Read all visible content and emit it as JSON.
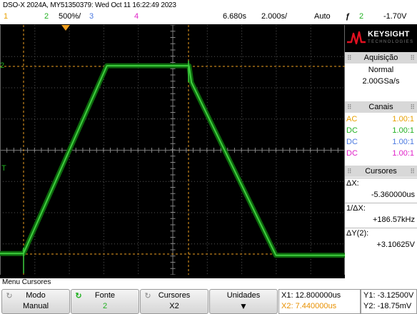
{
  "header": {
    "title": "DSO-X 2024A, MY51350379: Wed Oct 11 16:22:49 2023",
    "ch1_label": "1",
    "ch2_label": "2",
    "ch2_scale": "500%/",
    "ch3_label": "3",
    "ch4_label": "4",
    "timebase_delay": "6.680s",
    "timebase_scale": "2.000s/",
    "trigger_mode": "Auto",
    "trigger_symbol": "ƒ",
    "trigger_source": "2",
    "trigger_level": "-1.70V"
  },
  "logo": {
    "brand": "KEYSIGHT",
    "sub": "TECHNOLOGIES"
  },
  "acquisition": {
    "title": "Aquisição",
    "mode": "Normal",
    "rate": "2.00GSa/s"
  },
  "channels": {
    "title": "Canais",
    "rows": [
      {
        "coupling": "AC",
        "probe": "1.00:1",
        "color": "#e8a000"
      },
      {
        "coupling": "DC",
        "probe": "1.00:1",
        "color": "#20b020"
      },
      {
        "coupling": "DC",
        "probe": "1.00:1",
        "color": "#4a78e0"
      },
      {
        "coupling": "DC",
        "probe": "1.00:1",
        "color": "#e020c8"
      }
    ]
  },
  "cursors": {
    "title": "Cursores",
    "dx_label": "ΔX:",
    "dx_value": "-5.360000us",
    "inv_dx_label": "1/ΔX:",
    "inv_dx_value": "+186.57kHz",
    "dy_label": "ΔY(2):",
    "dy_value": "+3.10625V"
  },
  "menu": {
    "title": "Menu Cursores",
    "mode_label": "Modo",
    "mode_value": "Manual",
    "source_label": "Fonte",
    "source_value": "2",
    "cursors_label": "Cursores",
    "cursors_value": "X2",
    "units_label": "Unidades",
    "x1": "X1: 12.800000us",
    "x2": "X2: 7.440000us",
    "y1": "Y1: -3.12500V",
    "y2": "Y2: -18.75mV"
  },
  "markers": {
    "ch2_ground": "2",
    "trigger_T": "T"
  },
  "colors": {
    "ch1": "#e8a000",
    "ch2": "#20b020",
    "ch3": "#4a78e0",
    "ch4": "#e020c8",
    "cursor": "#f0a020"
  },
  "waveform": {
    "description_points_fraction": [
      [
        0.0,
        0.915
      ],
      [
        0.068,
        0.915
      ],
      [
        0.31,
        0.163
      ],
      [
        0.548,
        0.163
      ],
      [
        0.555,
        0.23
      ],
      [
        0.8,
        0.922
      ],
      [
        1.0,
        0.922
      ]
    ]
  }
}
